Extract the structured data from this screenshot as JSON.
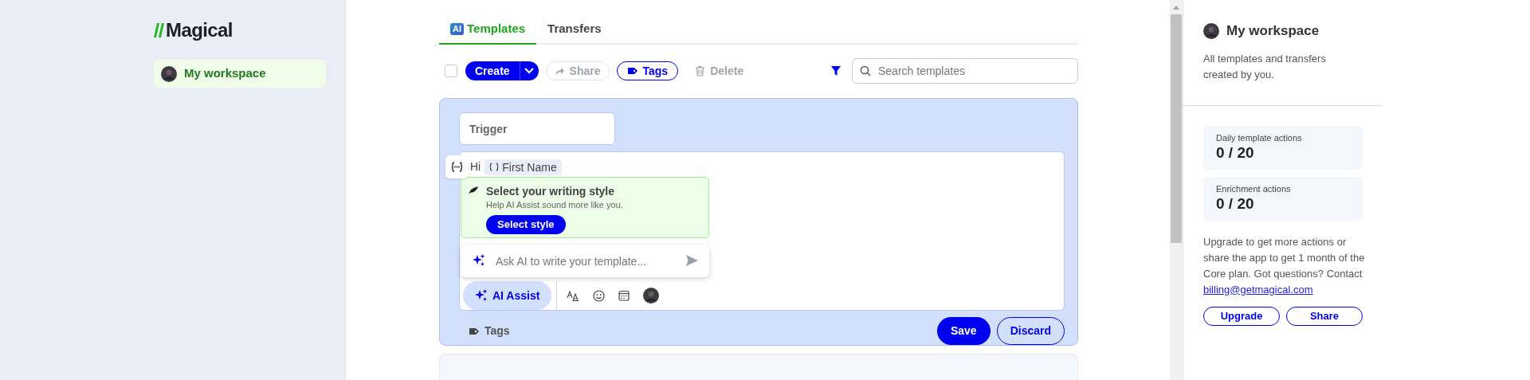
{
  "logo": {
    "text": "Magical"
  },
  "sidebar": {
    "items": [
      {
        "label": "My workspace",
        "selected": true
      }
    ]
  },
  "tabs": [
    {
      "label": "Templates",
      "badge": "AI",
      "selected": true
    },
    {
      "label": "Transfers",
      "selected": false
    }
  ],
  "toolbar": {
    "select_all_checked": false,
    "create": "Create",
    "share": {
      "label": "Share",
      "disabled": true
    },
    "tags": "Tags",
    "delete": {
      "label": "Delete",
      "disabled": true
    },
    "search": {
      "placeholder": "Search templates"
    }
  },
  "editor": {
    "trigger": {
      "placeholder": "Trigger"
    },
    "greeting": "Hi",
    "variable_chip": "First Name",
    "style_prompt": {
      "title": "Select your writing style",
      "subtitle": "Help AI Assist sound more like you.",
      "button": "Select style"
    },
    "ai_prompt": {
      "placeholder": "Ask AI to write your template..."
    },
    "ai_assist": "AI Assist",
    "tags": "Tags",
    "save": "Save",
    "discard": "Discard"
  },
  "workspace_panel": {
    "title": "My workspace",
    "description": "All templates and transfers created by you.",
    "stats": [
      {
        "label": "Daily template actions",
        "value": "0 / 20"
      },
      {
        "label": "Enrichment actions",
        "value": "0 / 20"
      }
    ],
    "upgrade_text": "Upgrade to get more actions or share the app to get 1 month of the Core plan. Got questions? Contact",
    "email": "billing@getmagical.com",
    "buttons": [
      "Upgrade",
      "Share"
    ]
  }
}
